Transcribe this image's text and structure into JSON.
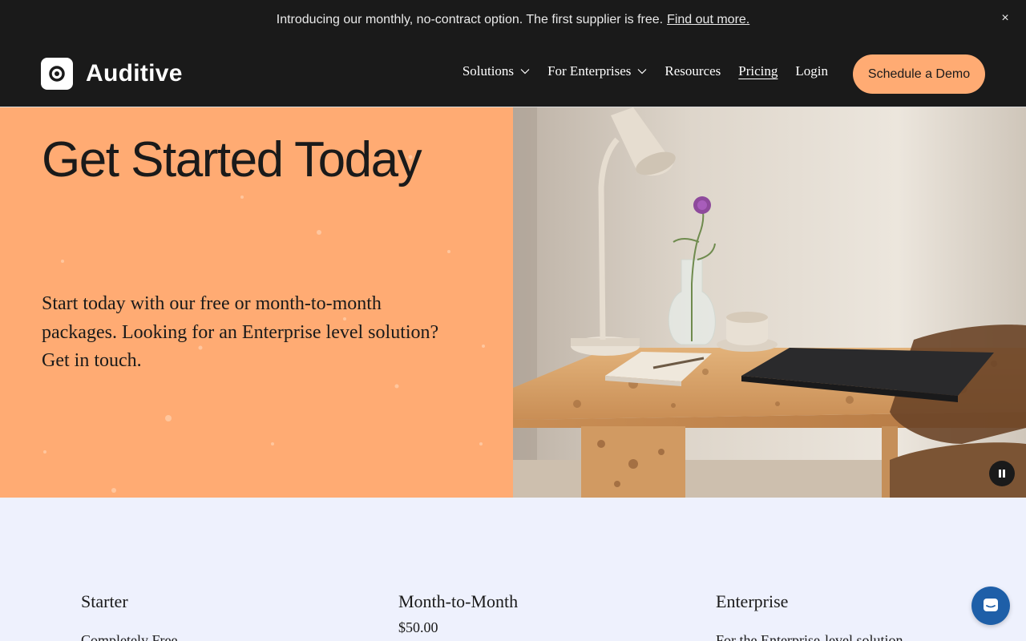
{
  "announcement": {
    "text": "Introducing our monthly, no-contract option. The first supplier is free.",
    "link": "Find out more.",
    "close_icon": "×"
  },
  "nav": {
    "brand": "Auditive",
    "items": [
      {
        "label": "Solutions",
        "dropdown": true
      },
      {
        "label": "For Enterprises",
        "dropdown": true
      },
      {
        "label": "Resources",
        "dropdown": false
      },
      {
        "label": "Pricing",
        "dropdown": false,
        "active": true
      },
      {
        "label": "Login",
        "dropdown": false
      }
    ],
    "cta": "Schedule a Demo"
  },
  "hero": {
    "title": "Get Started Today",
    "body": "Start today with our free or month-to-month packages. Looking for an Enterprise level solution? Get in touch.",
    "image_alt": "desk-with-lamp-laptop-and-flower-vase"
  },
  "pricing": {
    "plans": [
      {
        "name": "Starter",
        "subtitle": "Completely Free"
      },
      {
        "name": "Month-to-Month",
        "subtitle": "$50.00"
      },
      {
        "name": "Enterprise",
        "subtitle": "For the Enterprise-level solution"
      }
    ]
  },
  "colors": {
    "dark": "#1a1a1a",
    "accent": "#ffab73",
    "light_bg": "#eef1fd",
    "chat": "#1e5fa8"
  },
  "icons": {
    "logo": "logo-ring-icon",
    "chevron": "chevron-down-icon",
    "pause": "pause-icon",
    "chat": "chat-bubble-icon",
    "close": "close-icon"
  }
}
